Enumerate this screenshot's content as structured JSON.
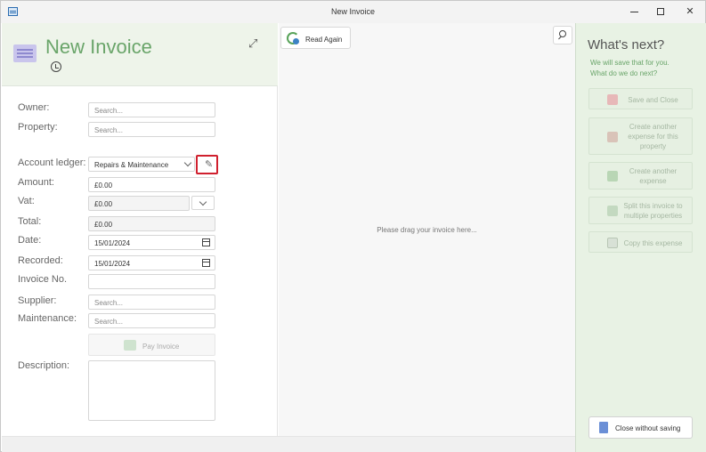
{
  "window": {
    "title": "New Invoice"
  },
  "header": {
    "title": "New Invoice"
  },
  "form": {
    "owner": {
      "label": "Owner:",
      "placeholder": "Search..."
    },
    "property": {
      "label": "Property:",
      "placeholder": "Search..."
    },
    "account_ledger": {
      "label": "Account ledger:",
      "value": "Repairs & Maintenance"
    },
    "amount": {
      "label": "Amount:",
      "value": "£0.00"
    },
    "vat": {
      "label": "Vat:",
      "value": "£0.00"
    },
    "total": {
      "label": "Total:",
      "value": "£0.00"
    },
    "date": {
      "label": "Date:",
      "value": "15/01/2024"
    },
    "recorded": {
      "label": "Recorded:",
      "value": "15/01/2024"
    },
    "invoice_no": {
      "label": "Invoice No.",
      "value": ""
    },
    "supplier": {
      "label": "Supplier:",
      "placeholder": "Search..."
    },
    "maintenance": {
      "label": "Maintenance:",
      "placeholder": "Search..."
    },
    "pay_invoice_label": "Pay Invoice",
    "description": {
      "label": "Description:",
      "value": ""
    }
  },
  "middle": {
    "read_again_label": "Read Again",
    "drag_text": "Please drag your invoice here..."
  },
  "right": {
    "title": "What's next?",
    "subtitle_line1": "We will save that for you.",
    "subtitle_line2": "What do we do next?",
    "actions": [
      {
        "label": "Save and Close",
        "icon": "save-icon"
      },
      {
        "label": "Create another expense for this property",
        "icon": "house-expense-icon"
      },
      {
        "label": "Create another expense",
        "icon": "money-icon"
      },
      {
        "label": "Split this invoice to multiple properties",
        "icon": "split-icon"
      },
      {
        "label": "Copy this expense",
        "icon": "copy-icon"
      }
    ],
    "close_label": "Close without saving"
  },
  "colors": {
    "accent_green": "#6aa56a",
    "highlight_red": "#d0202e",
    "right_panel_bg": "#e8f2e4"
  }
}
